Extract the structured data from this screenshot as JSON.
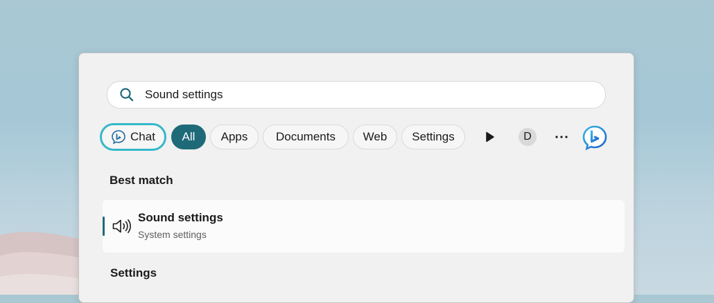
{
  "search": {
    "value": "Sound settings",
    "icon": "search-icon"
  },
  "filters": {
    "chat": "Chat",
    "all": "All",
    "apps": "Apps",
    "documents": "Documents",
    "web": "Web",
    "settings": "Settings",
    "avatar_initial": "D"
  },
  "best_match": {
    "title": "Best match",
    "result_name": "Sound settings",
    "result_type": "System settings",
    "icon": "speaker-icon"
  },
  "settings_section": {
    "title": "Settings"
  },
  "colors": {
    "accent": "#1f6a79",
    "chat_border": "#34b7c9",
    "panel_bg": "#f1f1f1"
  }
}
